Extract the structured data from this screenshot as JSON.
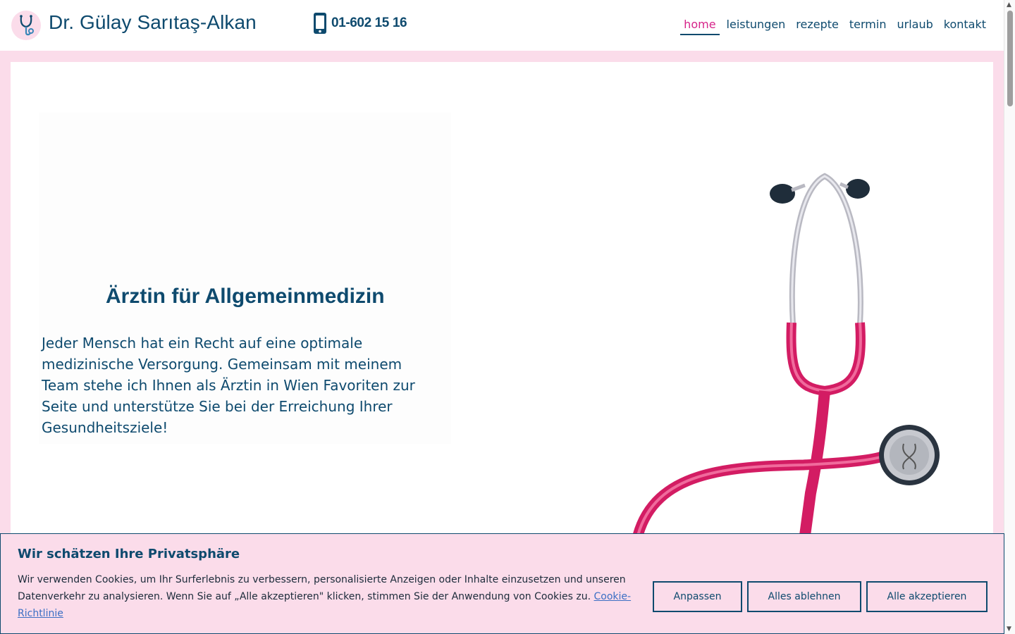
{
  "header": {
    "brand": "Dr. Gülay Sarıtaş-Alkan",
    "phone": "01-602 15 16",
    "logo_icon": "stethoscope-icon",
    "phone_icon": "mobile-phone-icon"
  },
  "nav": {
    "items": [
      {
        "label": "home",
        "active": true
      },
      {
        "label": "leistungen",
        "active": false
      },
      {
        "label": "rezepte",
        "active": false
      },
      {
        "label": "termin",
        "active": false
      },
      {
        "label": "urlaub",
        "active": false
      },
      {
        "label": "kontakt",
        "active": false
      }
    ]
  },
  "hero": {
    "title": "Ärztin für Allgemeinmedizin",
    "text": "Jeder Mensch hat ein Recht auf eine optimale medizinische Versorgung. Gemeinsam mit meinem Team stehe ich Ihnen als Ärztin in Wien Favoriten zur Seite und unterstütze Sie bei der Erreichung Ihrer Gesundheitsziele!"
  },
  "cookie": {
    "title": "Wir schätzen Ihre Privatsphäre",
    "text": "Wir verwenden Cookies, um Ihr Surferlebnis zu verbessern, personalisierte Anzeigen oder Inhalte einzusetzen und unseren Datenverkehr zu analysieren. Wenn Sie auf „Alle akzeptieren\" klicken, stimmen Sie der Anwendung von Cookies zu.",
    "link": "Cookie-Richtlinie",
    "buttons": {
      "customize": "Anpassen",
      "reject": "Alles ablehnen",
      "accept": "Alle akzeptieren"
    }
  },
  "colors": {
    "brand_blue": "#0e4a6e",
    "accent_pink": "#d6248a",
    "frame_pink": "#fbdcea"
  }
}
